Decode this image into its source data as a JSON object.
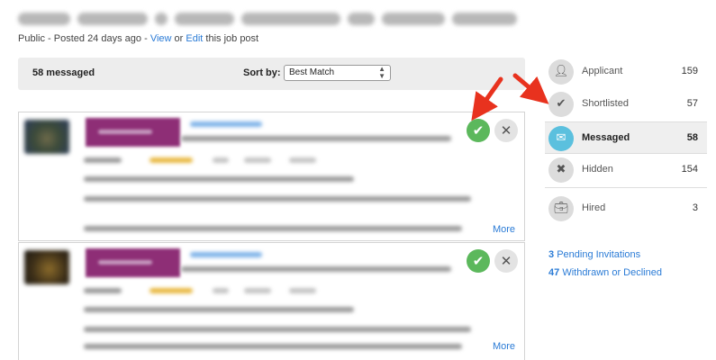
{
  "meta": {
    "visibility": "Public",
    "posted": "Posted 24 days ago",
    "sep": "-",
    "view_link": "View",
    "or": "or",
    "edit_link": "Edit",
    "suffix": "this job post"
  },
  "toolbar": {
    "count": "58 messaged",
    "sort_label": "Sort by:",
    "sort_value": "Best Match"
  },
  "cards": [
    {
      "accept_icon": "check-icon",
      "reject_icon": "close-icon",
      "more": "More"
    },
    {
      "accept_icon": "check-icon",
      "reject_icon": "close-icon",
      "more": "More"
    }
  ],
  "sidebar": {
    "items": [
      {
        "icon": "person-icon",
        "label": "Applicant",
        "count": "159"
      },
      {
        "icon": "check-icon",
        "label": "Shortlisted",
        "count": "57"
      },
      {
        "icon": "envelope-icon",
        "label": "Messaged",
        "count": "58"
      },
      {
        "icon": "close-icon",
        "label": "Hidden",
        "count": "154"
      },
      {
        "icon": "briefcase-icon",
        "label": "Hired",
        "count": "3"
      }
    ],
    "links": [
      {
        "num": "3",
        "text": "Pending Invitations"
      },
      {
        "num": "47",
        "text": "Withdrawn or Declined"
      }
    ],
    "active": "Messaged"
  },
  "colors": {
    "accept": "#5cb85c",
    "active_icon": "#5bc0de",
    "link": "#2a7bd6",
    "annotation_arrow": "#e8321e"
  }
}
